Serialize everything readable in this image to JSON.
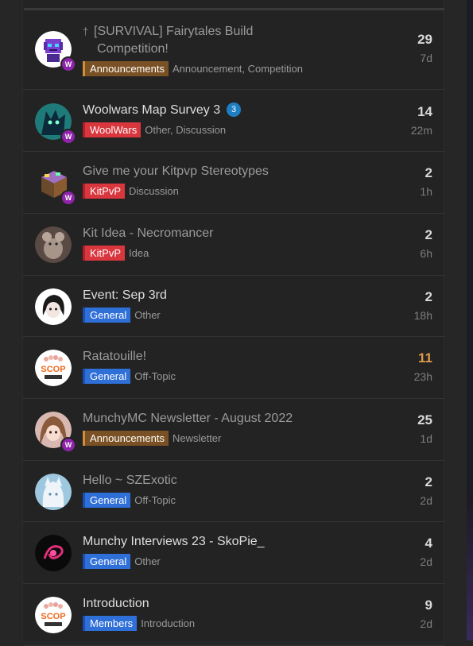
{
  "topics": [
    {
      "avatar_icon": "pixel-robot-avatar-icon",
      "has_badge": true,
      "pinned": true,
      "title": "[SURVIVAL] Fairytales Build",
      "title_cont": "Competition!",
      "category": "Announcements",
      "category_color": "#7a5124",
      "category_border": "#d08d3a",
      "tags": "Announcement, Competition",
      "posts": "29",
      "age": "7d",
      "read": true
    },
    {
      "avatar_icon": "dragon-avatar-icon",
      "has_badge": true,
      "title": "Woolwars Map Survey 3",
      "unread": "3",
      "category": "WoolWars",
      "category_color": "#d9363e",
      "category_border": "#b0202a",
      "tags": "Other, Discussion",
      "posts": "14",
      "age": "22m",
      "read": false
    },
    {
      "avatar_icon": "minecraft-block-avatar-icon",
      "has_badge": true,
      "title": "Give me your Kitpvp Stereotypes",
      "category": "KitPvP",
      "category_color": "#d9363e",
      "category_border": "#b0202a",
      "tags": "Discussion",
      "posts": "2",
      "age": "1h",
      "read": true
    },
    {
      "avatar_icon": "rat-avatar-icon",
      "has_badge": false,
      "title": "Kit Idea - Necromancer",
      "category": "KitPvP",
      "category_color": "#d9363e",
      "category_border": "#b0202a",
      "tags": "Idea",
      "posts": "2",
      "age": "6h",
      "read": true
    },
    {
      "avatar_icon": "anime-girl-sketch-avatar-icon",
      "has_badge": false,
      "title": "Event: Sep 3rd",
      "category": "General",
      "category_color": "#2f6fd8",
      "category_border": "#1d4fb0",
      "tags": "Other",
      "posts": "2",
      "age": "18h",
      "read": false
    },
    {
      "avatar_icon": "scop-logo-avatar-icon",
      "has_badge": false,
      "title": "Ratatouille!",
      "category": "General",
      "category_color": "#2f6fd8",
      "category_border": "#1d4fb0",
      "tags": "Off-Topic",
      "posts": "11",
      "age": "23h",
      "read": true,
      "hot": true
    },
    {
      "avatar_icon": "anime-girl-avatar-icon",
      "has_badge": true,
      "title": "MunchyMC Newsletter - August 2022",
      "category": "Announcements",
      "category_color": "#7a5124",
      "category_border": "#d08d3a",
      "tags": "Newsletter",
      "posts": "25",
      "age": "1d",
      "read": true
    },
    {
      "avatar_icon": "white-fox-avatar-icon",
      "has_badge": false,
      "title": "Hello ~ SZExotic",
      "category": "General",
      "category_color": "#2f6fd8",
      "category_border": "#1d4fb0",
      "tags": "Off-Topic",
      "posts": "2",
      "age": "2d",
      "read": true
    },
    {
      "avatar_icon": "neon-swirl-avatar-icon",
      "has_badge": false,
      "title": "Munchy Interviews 23 - SkoPie_",
      "category": "General",
      "category_color": "#2f6fd8",
      "category_border": "#1d4fb0",
      "tags": "Other",
      "posts": "4",
      "age": "2d",
      "read": false
    },
    {
      "avatar_icon": "scop-logo-avatar-icon",
      "has_badge": false,
      "title": "Introduction",
      "category": "Members",
      "category_color": "#2f6fd8",
      "category_border": "#1d4fb0",
      "tags": "Introduction",
      "posts": "9",
      "age": "2d",
      "read": false
    }
  ],
  "avatar_text": {
    "scop": "SCOP"
  },
  "badge_glyph": "W"
}
